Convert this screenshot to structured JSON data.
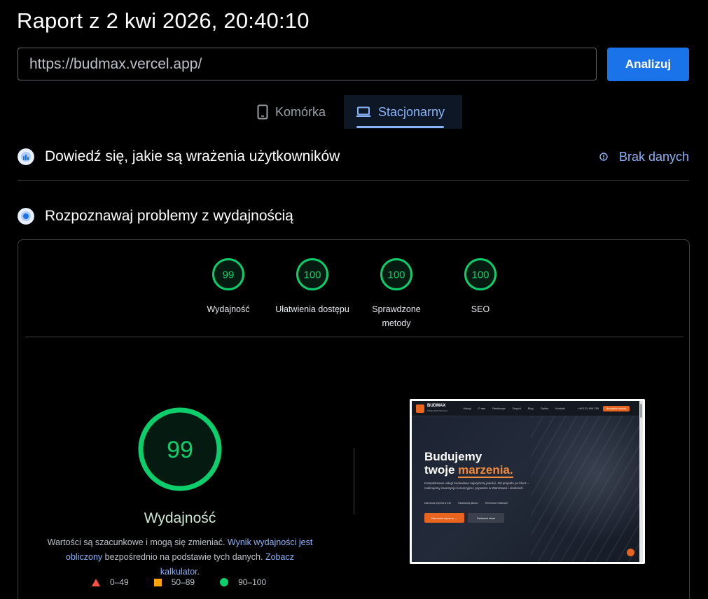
{
  "report": {
    "title": "Raport z 2 kwi 2026, 20:40:10"
  },
  "search": {
    "url": "https://budmax.vercel.app/",
    "analyze_label": "Analizuj"
  },
  "tabs": [
    {
      "label": "Komórka",
      "icon": "phone-icon",
      "active": false
    },
    {
      "label": "Stacjonarny",
      "icon": "laptop-icon",
      "active": true
    }
  ],
  "field_data": {
    "title": "Dowiedź się, jakie są wrażenia użytkowników",
    "status": "Brak danych"
  },
  "lab": {
    "title": "Rozpoznawaj problemy z wydajnością",
    "categories": [
      {
        "score": "99",
        "label": "Wydajność",
        "value": 99
      },
      {
        "score": "100",
        "label": "Ułatwienia dostępu",
        "value": 100
      },
      {
        "score": "100",
        "label": "Sprawdzone metody",
        "value": 100
      },
      {
        "score": "100",
        "label": "SEO",
        "value": 100
      }
    ],
    "main_score": "99",
    "main_value": 99,
    "main_label": "Wydajność",
    "desc_prefix": "Wartości są szacunkowe i mogą się zmieniać. ",
    "desc_link1": "Wynik wydajności jest obliczony",
    "desc_mid": " bezpośrednio na podstawie tych danych. ",
    "desc_link2": "Zobacz kalkulator",
    "desc_suffix": ".",
    "legend": [
      {
        "range": "0–49",
        "color": "#ff4e42"
      },
      {
        "range": "50–89",
        "color": "#ffa400"
      },
      {
        "range": "90–100",
        "color": "#0cce6b"
      }
    ]
  },
  "screenshot": {
    "logo": "BUDMAX",
    "logo_sub": "FIRMA BUDOWLANA",
    "nav": [
      "Usługi",
      "O nas",
      "Realizacje",
      "Zespół",
      "Blog",
      "Opinie",
      "Kontakt"
    ],
    "phone": "+48 123 456 789",
    "cta": "Bezpłatna wycena",
    "hero_line1": "Budujemy",
    "hero_line2a": "twoje ",
    "hero_line2b": "marzenia.",
    "hero_text": "Kompleksowe usługi budowlane najwyższej jakości. Od projektu po klucz – realizujemy inwestycje komercyjne i prywatne w Warszawie i okolicach.",
    "bullets": [
      "Darmowa wycena w 24h",
      "Gwarancja jakości",
      "Terminowe realizacje"
    ],
    "btn_primary": "Darmowa wycena →",
    "btn_secondary": "Zadzwoń teraz"
  },
  "colors": {
    "accent": "#1a73e8",
    "pass": "#0cce6b",
    "link": "#8ab4f8",
    "brand_orange": "#e8641f"
  }
}
